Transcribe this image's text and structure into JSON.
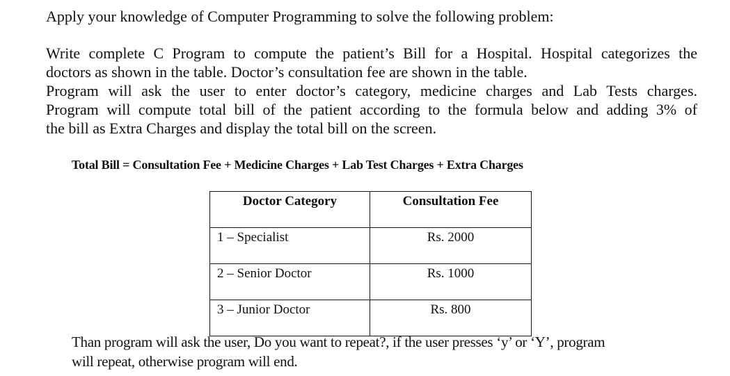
{
  "intro": "Apply your knowledge of Computer Programming to solve the following problem:",
  "problem_lines": [
    "Write complete C Program to compute the patient’s Bill for a Hospital. Hospital categorizes the",
    "doctors as shown in the table. Doctor’s consultation fee are shown in the table.",
    "Program will ask the user to enter doctor’s category, medicine charges and Lab Tests charges.",
    "Program will compute total bill of the patient according to the formula below and adding 3% of",
    "the bill as  Extra Charges and display the total bill on the screen."
  ],
  "formula": "Total Bill =  Consultation Fee +  Medicine Charges + Lab Test Charges + Extra Charges",
  "table": {
    "headers": [
      "Doctor Category",
      "Consultation Fee"
    ],
    "rows": [
      {
        "category": "1 – Specialist",
        "fee": "Rs. 2000"
      },
      {
        "category": "2 – Senior Doctor",
        "fee": "Rs. 1000"
      },
      {
        "category": "3 – Junior Doctor",
        "fee": "Rs. 800"
      }
    ]
  },
  "closing_lines": [
    "Than program will ask the user, Do you want to repeat?, if the user presses ‘y’ or ‘Y’, program",
    "will repeat, otherwise program will end."
  ]
}
